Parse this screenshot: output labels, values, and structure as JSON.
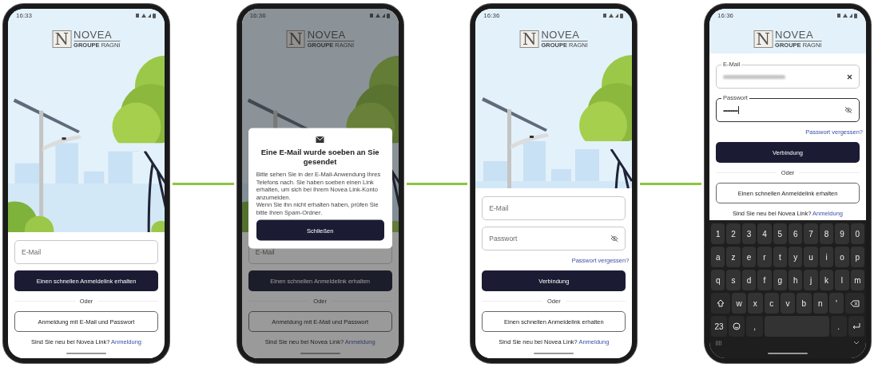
{
  "phones": [
    {
      "time": "16:33",
      "logo": {
        "mark": "N",
        "name": "NOVEA",
        "group": "GROUPE",
        "group_suffix": "RAGNI"
      },
      "fields": [
        {
          "kind": "outlined",
          "placeholder": "E-Mail",
          "focused": false
        }
      ],
      "primary_button": "Einen schnellen Anmeldelink erhalten",
      "divider": "Oder",
      "secondary_button": "Anmeldung mit E-Mail und Passwort",
      "signup": {
        "prompt": "Sind Sie neu bei Novea Link?",
        "link": "Anmeldung"
      }
    },
    {
      "time": "16:36",
      "logo": {
        "mark": "N",
        "name": "NOVEA",
        "group": "GROUPE",
        "group_suffix": "RAGNI"
      },
      "fields": [
        {
          "kind": "outlined",
          "placeholder": "E-Mail",
          "focused": false
        }
      ],
      "primary_button": "Einen schnellen Anmeldelink erhalten",
      "divider": "Oder",
      "secondary_button": "Anmeldung mit E-Mail und Passwort",
      "signup": {
        "prompt": "Sind Sie neu bei Novea Link?",
        "link": "Anmeldung"
      },
      "dialog": {
        "title": "Eine E-Mail wurde soeben an Sie gesendet",
        "paragraphs": [
          "Bitte sehen Sie in der E-Mail-Anwendung Ihres Telefons nach. Sie haben soeben einen Link erhalten, um sich bei Ihrem Novea Link-Konto anzumelden.",
          "Wenn Sie ihn nicht erhalten haben, prüfen Sie bitte Ihren Spam-Ordner."
        ],
        "button": "Schließen"
      }
    },
    {
      "time": "16:36",
      "logo": {
        "mark": "N",
        "name": "NOVEA",
        "group": "GROUPE",
        "group_suffix": "RAGNI"
      },
      "fields": [
        {
          "kind": "outlined",
          "placeholder": "E-Mail",
          "focused": false
        },
        {
          "kind": "outlined",
          "placeholder": "Passwort",
          "visibility_toggle": true,
          "focused": false
        }
      ],
      "forgot_link": "Passwort vergessen?",
      "primary_button": "Verbindung",
      "divider": "Oder",
      "secondary_button": "Einen schnellen Anmeldelink erhalten",
      "signup": {
        "prompt": "Sind Sie neu bei Novea Link?",
        "link": "Anmeldung"
      }
    },
    {
      "time": "16:36",
      "logo": {
        "mark": "N",
        "name": "NOVEA",
        "group": "GROUPE",
        "group_suffix": "RAGNI"
      },
      "fields": [
        {
          "kind": "floating",
          "label": "E-Mail",
          "redacted": true,
          "clear_button": true,
          "focused": false
        },
        {
          "kind": "floating",
          "label": "Passwort",
          "value": "••••••••••",
          "visibility_toggle": true,
          "focused": true
        }
      ],
      "forgot_link": "Passwort vergessen?",
      "primary_button": "Verbindung",
      "divider": "Oder",
      "secondary_button": "Einen schnellen Anmeldelink erhalten",
      "signup": {
        "prompt": "Sind Sie neu bei Novea Link?",
        "link": "Anmeldung"
      },
      "keyboard": {
        "rows": [
          [
            "1",
            "2",
            "3",
            "4",
            "5",
            "6",
            "7",
            "8",
            "9",
            "0"
          ],
          [
            "a",
            "z",
            "e",
            "r",
            "t",
            "y",
            "u",
            "i",
            "o",
            "p"
          ],
          [
            "q",
            "s",
            "d",
            "f",
            "g",
            "h",
            "j",
            "k",
            "l",
            "m"
          ]
        ],
        "shift_row": [
          "w",
          "x",
          "c",
          "v",
          "b",
          "n",
          "'"
        ],
        "symbols_key": "23",
        "comma_key": ",",
        "period_key": "."
      }
    }
  ]
}
